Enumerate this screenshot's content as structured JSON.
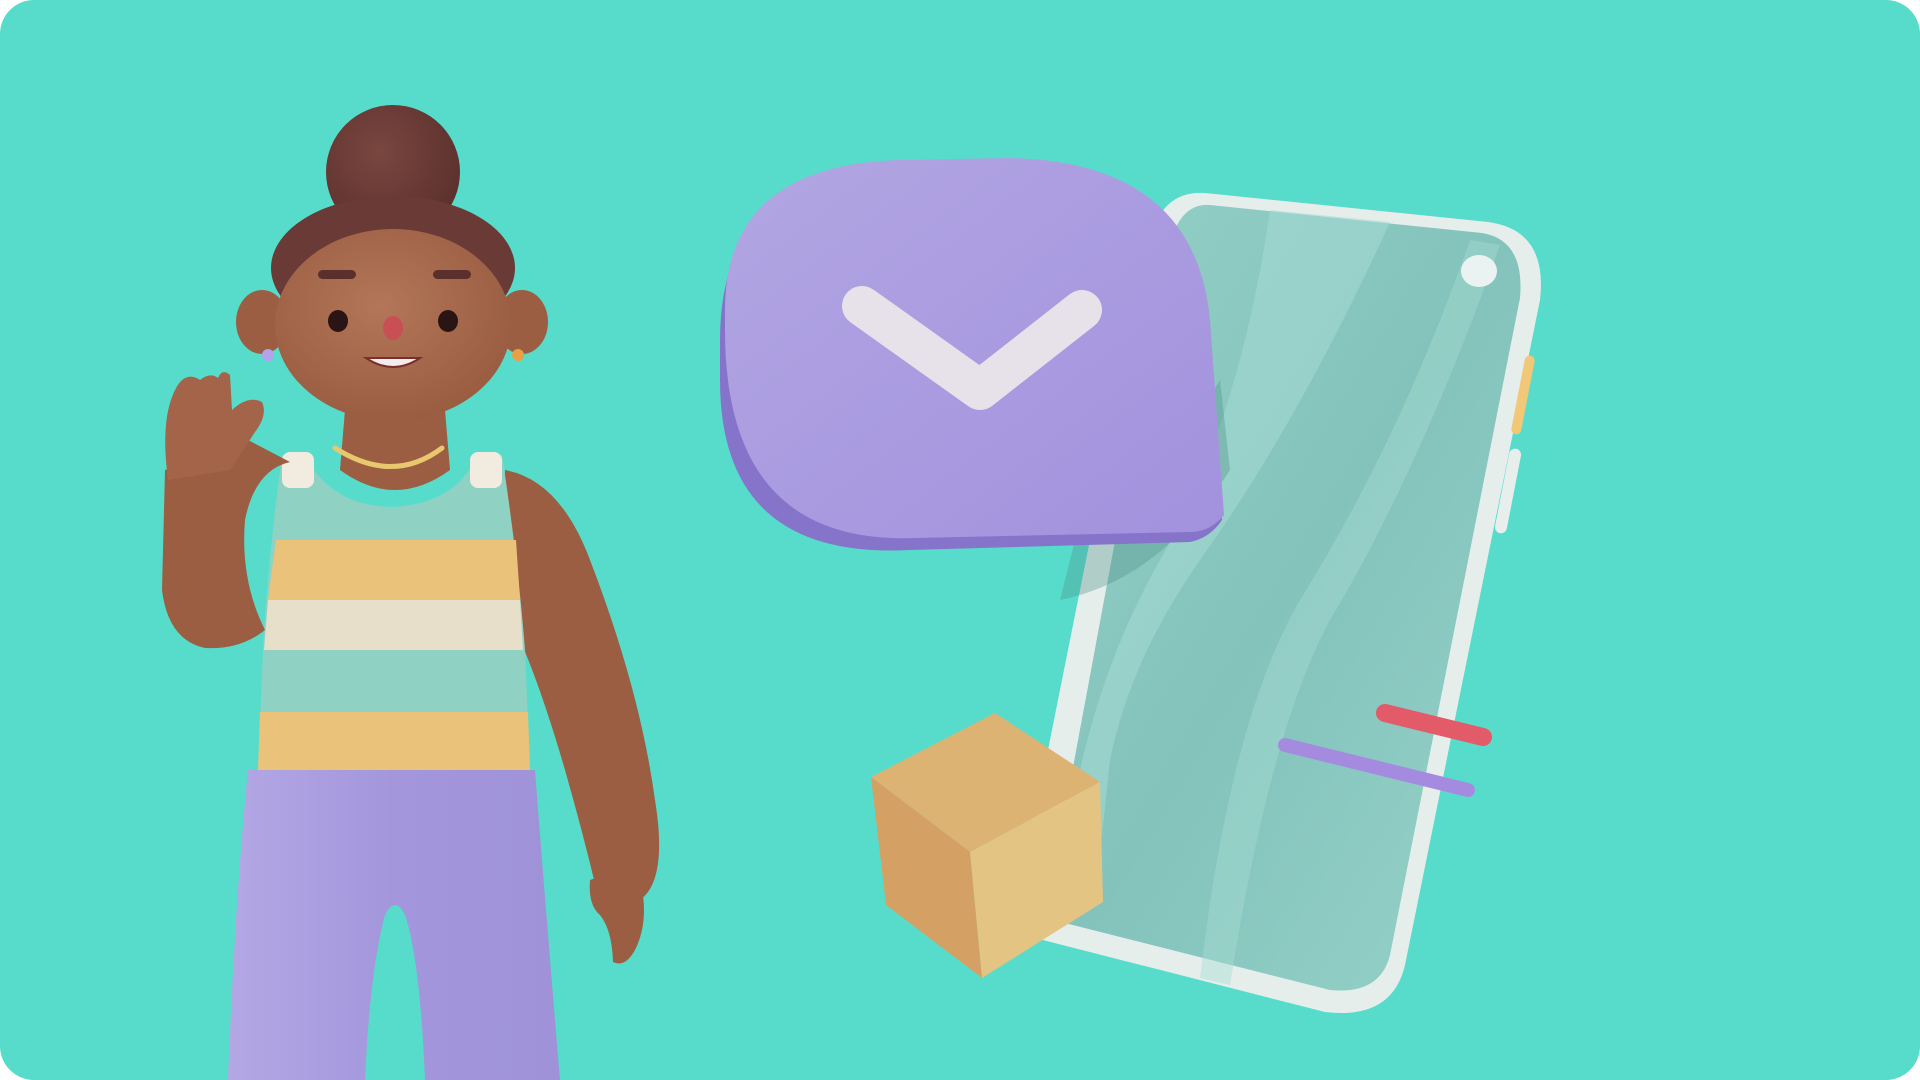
{
  "scene": {
    "type": "3d-illustration",
    "subject": "person-waving-beside-smartphone",
    "elements": [
      "waving-person",
      "speech-bubble",
      "checkmark-icon",
      "smartphone",
      "parcel-box",
      "screen-line-pink",
      "screen-line-purple"
    ]
  },
  "colors": {
    "background": "#57DCCB",
    "bubble": "#A99BDE",
    "bubble_shadow": "#8372C9",
    "checkmark": "#E9E4EC",
    "phone_frame": "#E7EEEC",
    "phone_screen": "#86C8C0",
    "box_top": "#DDB374",
    "box_left": "#D8A566",
    "box_right": "#E4C482",
    "skin": "#A76A4C",
    "hair": "#6A3A36",
    "pants": "#AA9DDC",
    "stripe_teal": "#8FD2C4",
    "stripe_yellow": "#EAC27A",
    "stripe_cream": "#E8DFCB",
    "accent_pink": "#E35A68",
    "accent_purple": "#A48BE0"
  }
}
